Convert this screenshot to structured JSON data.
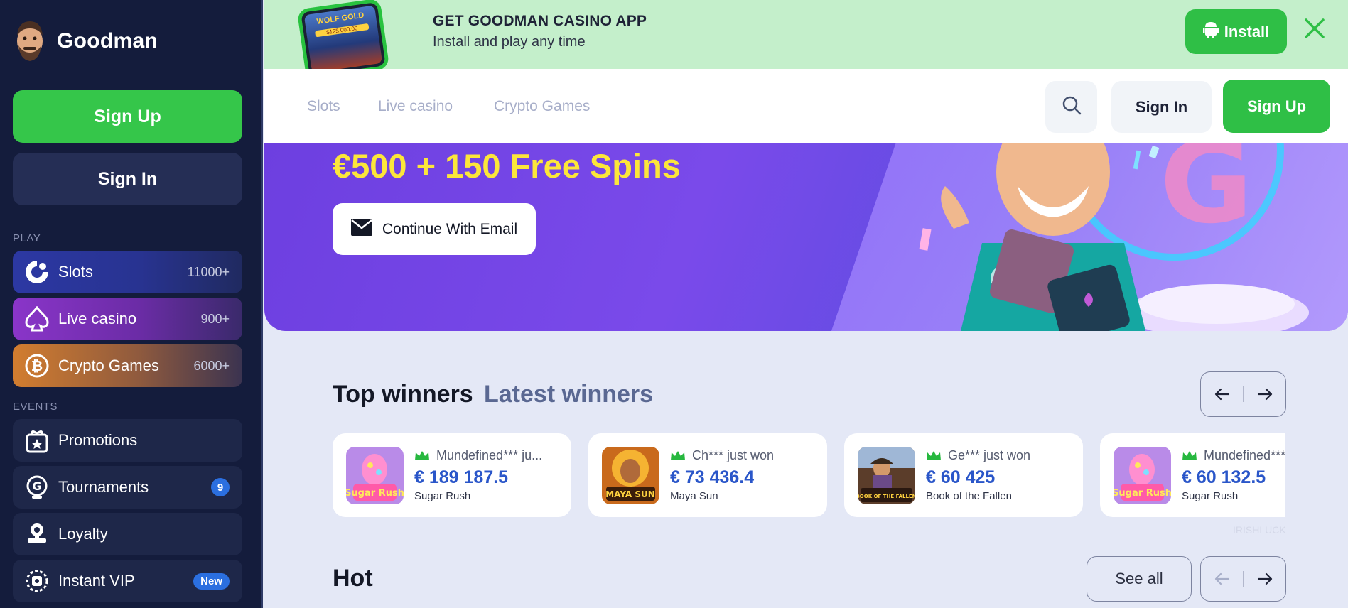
{
  "sidebar": {
    "logo": "Goodman",
    "signup_label": "Sign Up",
    "signin_label": "Sign In",
    "play_section": "PLAY",
    "events_section": "EVENTS",
    "play_items": [
      {
        "label": "Slots",
        "count": "11000+",
        "icon": "slots-icon"
      },
      {
        "label": "Live casino",
        "count": "900+",
        "icon": "spade-icon"
      },
      {
        "label": "Crypto Games",
        "count": "6000+",
        "icon": "bitcoin-icon"
      }
    ],
    "event_items": [
      {
        "label": "Promotions",
        "icon": "gift-icon"
      },
      {
        "label": "Tournaments",
        "badge": "9",
        "icon": "trophy-icon"
      },
      {
        "label": "Loyalty",
        "icon": "loyalty-icon"
      },
      {
        "label": "Instant VIP",
        "badge": "New",
        "icon": "vip-icon"
      }
    ]
  },
  "app_banner": {
    "phone_title": "WOLF GOLD",
    "phone_amount": "$125,000.00",
    "title": "GET GOODMAN CASINO APP",
    "subtitle": "Install and play any time",
    "install_label": "Install"
  },
  "nav": {
    "links": [
      "Slots",
      "Live casino",
      "Crypto Games"
    ],
    "signin_label": "Sign In",
    "signup_label": "Sign Up"
  },
  "hero": {
    "title": "€500 + 150 Free Spins",
    "email_button": "Continue With Email"
  },
  "winners": {
    "tab_top": "Top winners",
    "tab_latest": "Latest winners",
    "cards": [
      {
        "name": "Mundefined*** ju...",
        "amount": "€ 189 187.5",
        "game": "Sugar Rush",
        "thumb_text": "Sugar Rush"
      },
      {
        "name": "Ch*** just won",
        "amount": "€ 73 436.4",
        "game": "Maya Sun",
        "thumb_text": "MAYA SUN"
      },
      {
        "name": "Ge*** just won",
        "amount": "€ 60 425",
        "game": "Book of the Fallen",
        "thumb_text": "BOOK OF THE FALLEN"
      },
      {
        "name": "Mundefined***",
        "amount": "€ 60 132.5",
        "game": "Sugar Rush",
        "thumb_text": "Sugar Rush"
      }
    ],
    "watermark": "IRISHLUCK"
  },
  "hot": {
    "title": "Hot",
    "see_all": "See all"
  },
  "colors": {
    "sidebar_bg": "#141c3c",
    "brand_green": "#35c64a",
    "accent_blue": "#2a56c9",
    "hero_yellow": "#fce63a",
    "page_bg": "#e4e8f6"
  }
}
